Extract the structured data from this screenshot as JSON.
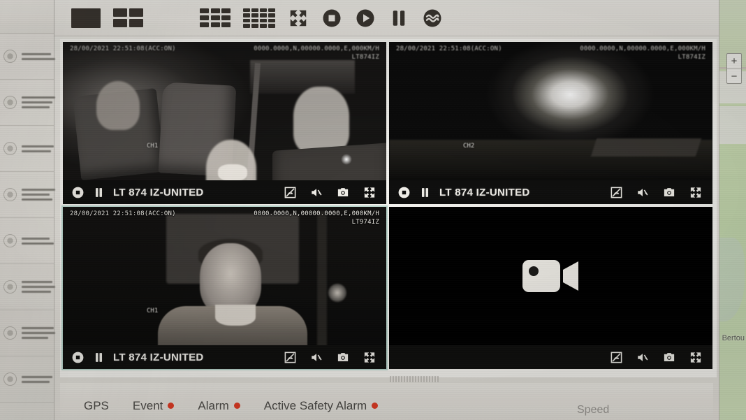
{
  "app": {
    "toolbar": {
      "items": [
        {
          "name": "layout-1",
          "icon": "layout-single-icon",
          "label": "1 Split"
        },
        {
          "name": "layout-4",
          "icon": "layout-quad-icon",
          "label": "4 Split"
        },
        {
          "name": "layout-6",
          "icon": "layout-six-icon",
          "label": "6 Split"
        },
        {
          "name": "layout-9",
          "icon": "layout-nine-icon",
          "label": "9 Split"
        },
        {
          "name": "layout-16",
          "icon": "layout-sixteen-icon",
          "label": "16 Split"
        },
        {
          "name": "fullscreen",
          "icon": "fullscreen-icon",
          "label": "Full Screen"
        },
        {
          "name": "stop-all",
          "icon": "stop-circle-icon",
          "label": "Stop All"
        },
        {
          "name": "play-all",
          "icon": "play-circle-icon",
          "label": "Play All"
        },
        {
          "name": "pause-all",
          "icon": "pause-icon",
          "label": "Pause All"
        },
        {
          "name": "stream-quality",
          "icon": "wave-circle-icon",
          "label": "Stream"
        }
      ]
    },
    "panels": [
      {
        "id": "panel-1",
        "channel_label": "CH1",
        "osd_datetime": "28/00/2021 22:51:08(ACC:ON)",
        "osd_gps": "0000.0000,N,00000.0000,E,000KM/H",
        "osd_plate": "LT874IZ",
        "title": "LT 874 IZ-UNITED",
        "scene": "cabin",
        "has_video": true,
        "selected": false
      },
      {
        "id": "panel-2",
        "channel_label": "CH2",
        "osd_datetime": "28/00/2021 22:51:08(ACC:ON)",
        "osd_gps": "0000.0000,N,00000.0000,E,000KM/H",
        "osd_plate": "LT874IZ",
        "title": "LT 874 IZ-UNITED",
        "scene": "night-road",
        "has_video": true,
        "selected": false
      },
      {
        "id": "panel-3",
        "channel_label": "CH1",
        "osd_datetime": "28/00/2021 22:51:08(ACC:ON)",
        "osd_gps": "0000.0000,N,00000.0000,E,000KM/H",
        "osd_plate": "LT974IZ",
        "title": "LT 874 IZ-UNITED",
        "scene": "driver-face",
        "has_video": true,
        "selected": true
      },
      {
        "id": "panel-4",
        "channel_label": "",
        "osd_datetime": "",
        "osd_gps": "",
        "osd_plate": "",
        "title": "",
        "scene": "no-signal",
        "has_video": false,
        "selected": false
      }
    ],
    "panel_controls": {
      "stop": "stop-icon",
      "pause": "pause-icon",
      "image_off": "image-disabled-icon",
      "mute": "mute-icon",
      "snapshot": "camera-icon",
      "expand": "expand-icon"
    },
    "status_bar": {
      "items": [
        {
          "label": "GPS",
          "dot": false
        },
        {
          "label": "Event",
          "dot": true
        },
        {
          "label": "Alarm",
          "dot": true
        },
        {
          "label": "Active Safety Alarm",
          "dot": true
        }
      ],
      "speed_label": "Speed",
      "dot_color": "#e23b24"
    }
  },
  "sidebar": {
    "items": [
      {
        "icon": "device-node-icon"
      },
      {
        "icon": "device-node-icon"
      },
      {
        "icon": "device-node-icon"
      },
      {
        "icon": "device-node-icon"
      },
      {
        "icon": "device-node-icon"
      },
      {
        "icon": "device-node-icon"
      },
      {
        "icon": "device-node-icon"
      },
      {
        "icon": "device-node-icon"
      }
    ]
  },
  "map": {
    "label": "Bertou",
    "zoom_in": "+",
    "zoom_out": "−"
  },
  "theme": {
    "accent": "#bcd8cf",
    "alarm_dot": "#e23b24",
    "panel_bg": "#000000",
    "chrome_bg": "#e9e6e0"
  }
}
